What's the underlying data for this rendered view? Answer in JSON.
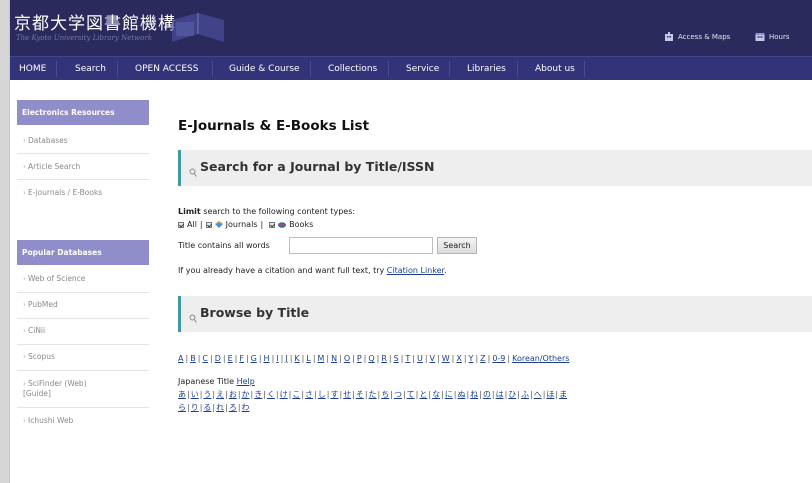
{
  "header": {
    "logo_jp": "京都大学図書館機構",
    "logo_en": "The Kyoto University Library Network",
    "links": [
      {
        "label": "Access & Maps",
        "icon": "building-icon"
      },
      {
        "label": "Hours",
        "icon": "calendar-icon"
      }
    ]
  },
  "nav": [
    "HOME",
    "Search",
    "OPEN ACCESS",
    "Guide & Course",
    "Collections",
    "Service",
    "Libraries",
    "About us"
  ],
  "sidebar": {
    "electronic": {
      "heading": "Electronics Resources",
      "items": [
        "Databases",
        "Article Search",
        "E-journals / E-Books"
      ]
    },
    "popular": {
      "heading": "Popular Databases",
      "items": [
        "Web of Science",
        "PubMed",
        "CiNii",
        "Scopus",
        "SciFinder (Web) [Guide]",
        "Ichushi Web"
      ]
    }
  },
  "main": {
    "title": "E-Journals & E-Books List",
    "search_section_title": "Search for a Journal by Title/ISSN",
    "limit_bold": "Limit",
    "limit_rest": " search to the following content types:",
    "types": [
      "All",
      "Journals",
      "Books"
    ],
    "type_sep": "|",
    "search_mode": "Title contains all words",
    "search_value": "",
    "search_button": "Search",
    "citation_text": "If you already have a citation and want full text, try ",
    "citation_link": "Citation Linker",
    "citation_end": ".",
    "browse_section_title": "Browse by Title",
    "letters": [
      "A",
      "B",
      "C",
      "D",
      "E",
      "F",
      "G",
      "H",
      "I",
      "J",
      "K",
      "L",
      "M",
      "N",
      "O",
      "P",
      "Q",
      "R",
      "S",
      "T",
      "U",
      "V",
      "W",
      "X",
      "Y",
      "Z",
      "0-9",
      "Korean/Others"
    ],
    "japanese_label": "Japanese Title ",
    "japanese_help": "Help",
    "kana_row1": [
      "あ",
      "い",
      "う",
      "え",
      "お",
      "か",
      "き",
      "く",
      "け",
      "こ",
      "さ",
      "し",
      "す",
      "せ",
      "そ",
      "た",
      "ち",
      "つ",
      "て",
      "と",
      "な",
      "に",
      "ぬ",
      "ね",
      "の",
      "は",
      "ひ",
      "ふ",
      "へ",
      "ほ",
      "ま"
    ],
    "kana_row2": [
      "ら",
      "り",
      "る",
      "れ",
      "ろ",
      "わ"
    ]
  },
  "colors": {
    "header_bg": "#2a2a5c",
    "nav_bg": "#33337a",
    "sidebar_heading_bg": "#8f8ecb",
    "section_accent": "#3f9aa6",
    "link": "#1d3f8f"
  }
}
